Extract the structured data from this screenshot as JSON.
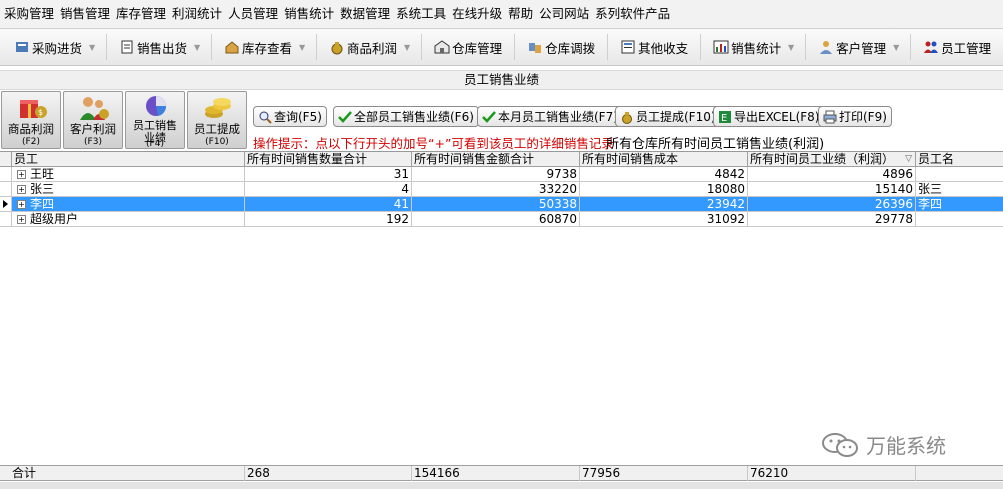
{
  "menu": [
    "采购管理",
    "销售管理",
    "库存管理",
    "利润统计",
    "人员管理",
    "销售统计",
    "数据管理",
    "系统工具",
    "在线升级",
    "帮助",
    "公司网站",
    "系列软件产品"
  ],
  "toolbar": [
    "采购进货",
    "销售出货",
    "库存查看",
    "商品利润",
    "仓库管理",
    "仓库调拨",
    "其他收支",
    "销售统计",
    "客户管理",
    "员工管理"
  ],
  "window_title": "员工销售业绩",
  "big_buttons": [
    {
      "label": "商品利润",
      "key": "(F2)"
    },
    {
      "label": "客户利润",
      "key": "(F3)"
    },
    {
      "label1": "员工销售",
      "label2": "业绩",
      "key": "(F4)"
    },
    {
      "label": "员工提成",
      "key": "(F10)"
    }
  ],
  "actions": {
    "query": "查询(F5)",
    "all": "全部员工销售业绩(F6)",
    "month": "本月员工销售业绩(F7)",
    "commission": "员工提成(F10)",
    "export": "导出EXCEL(F8)",
    "print": "打印(F9)"
  },
  "hint": "操作提示：点以下行开头的加号“+”可看到该员工的详细销售记录",
  "subtitle": "所有仓库所有时间员工销售业绩(利润)",
  "table": {
    "headers": [
      "员工",
      "所有时间销售数量合计",
      "所有时间销售金额合计",
      "所有时间销售成本",
      "所有时间员工业绩（利润）",
      "员工名"
    ],
    "sort_glyph": "▽",
    "expander": "+",
    "rows": [
      {
        "name": "王旺",
        "qty": "31",
        "amount": "9738",
        "cost": "4842",
        "profit": "4896",
        "staff": ""
      },
      {
        "name": "张三",
        "qty": "4",
        "amount": "33220",
        "cost": "18080",
        "profit": "15140",
        "staff": "张三"
      },
      {
        "name": "李四",
        "qty": "41",
        "amount": "50338",
        "cost": "23942",
        "profit": "26396",
        "staff": "李四"
      },
      {
        "name": "超级用户",
        "qty": "192",
        "amount": "60870",
        "cost": "31092",
        "profit": "29778",
        "staff": ""
      }
    ],
    "selected_row": 2,
    "footer": {
      "label": "合计",
      "qty": "268",
      "amount": "154166",
      "cost": "77956",
      "profit": "76210"
    }
  },
  "watermark": "万能系统",
  "colors": {
    "selection": "#3399ff",
    "hint": "#d40000"
  }
}
